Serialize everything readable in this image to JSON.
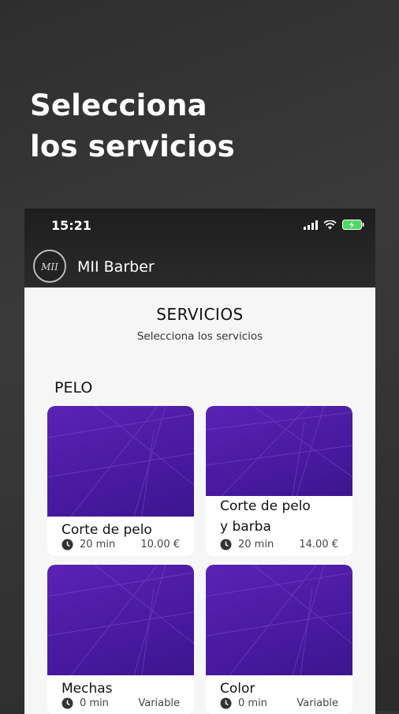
{
  "headline": {
    "line1": "Selecciona",
    "line2": "los servicios"
  },
  "status_bar": {
    "time": "15:21"
  },
  "app": {
    "title": "MII Barber",
    "logo_text": "MII"
  },
  "header": {
    "title": "SERVICIOS",
    "subtitle": "Selecciona los servicios"
  },
  "section": {
    "title": "PELO"
  },
  "services": [
    {
      "name": "Corte de pelo",
      "duration": "20 min",
      "price": "10.00 €"
    },
    {
      "name_line1": "Corte de pelo",
      "name_line2": "y barba",
      "duration": "20 min",
      "price": "14.00 €"
    },
    {
      "name": "Mechas",
      "duration": "0 min",
      "price": "Variable"
    },
    {
      "name": "Color",
      "duration": "0 min",
      "price": "Variable"
    }
  ],
  "colors": {
    "card_image": "#5a22b5",
    "app_bar": "#1e1e1e",
    "battery": "#4cd964"
  }
}
